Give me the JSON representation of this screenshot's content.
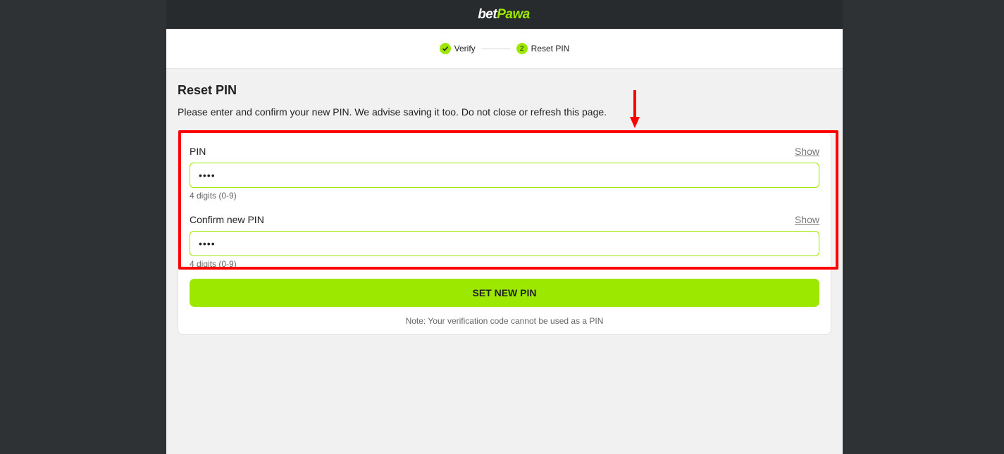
{
  "header": {
    "logo_text_1": "bet",
    "logo_text_2": "Pawa"
  },
  "stepper": {
    "steps": [
      {
        "label": "Verify",
        "state": "done",
        "icon": "check-icon"
      },
      {
        "label": "Reset PIN",
        "state": "current",
        "number": "2"
      }
    ]
  },
  "main": {
    "title": "Reset PIN",
    "description": "Please enter and confirm your new PIN. We advise saving it too. Do not close or refresh this page.",
    "fields": [
      {
        "label": "PIN",
        "show_label": "Show",
        "value": "••••",
        "hint": "4 digits (0-9)"
      },
      {
        "label": "Confirm new PIN",
        "show_label": "Show",
        "value": "••••",
        "hint": "4 digits (0-9)"
      }
    ],
    "submit_label": "SET NEW PIN",
    "note": "Note: Your verification code cannot be used as a PIN"
  },
  "colors": {
    "accent": "#9ce800",
    "topbar": "#272b2d",
    "annotation": "#ff0000"
  }
}
